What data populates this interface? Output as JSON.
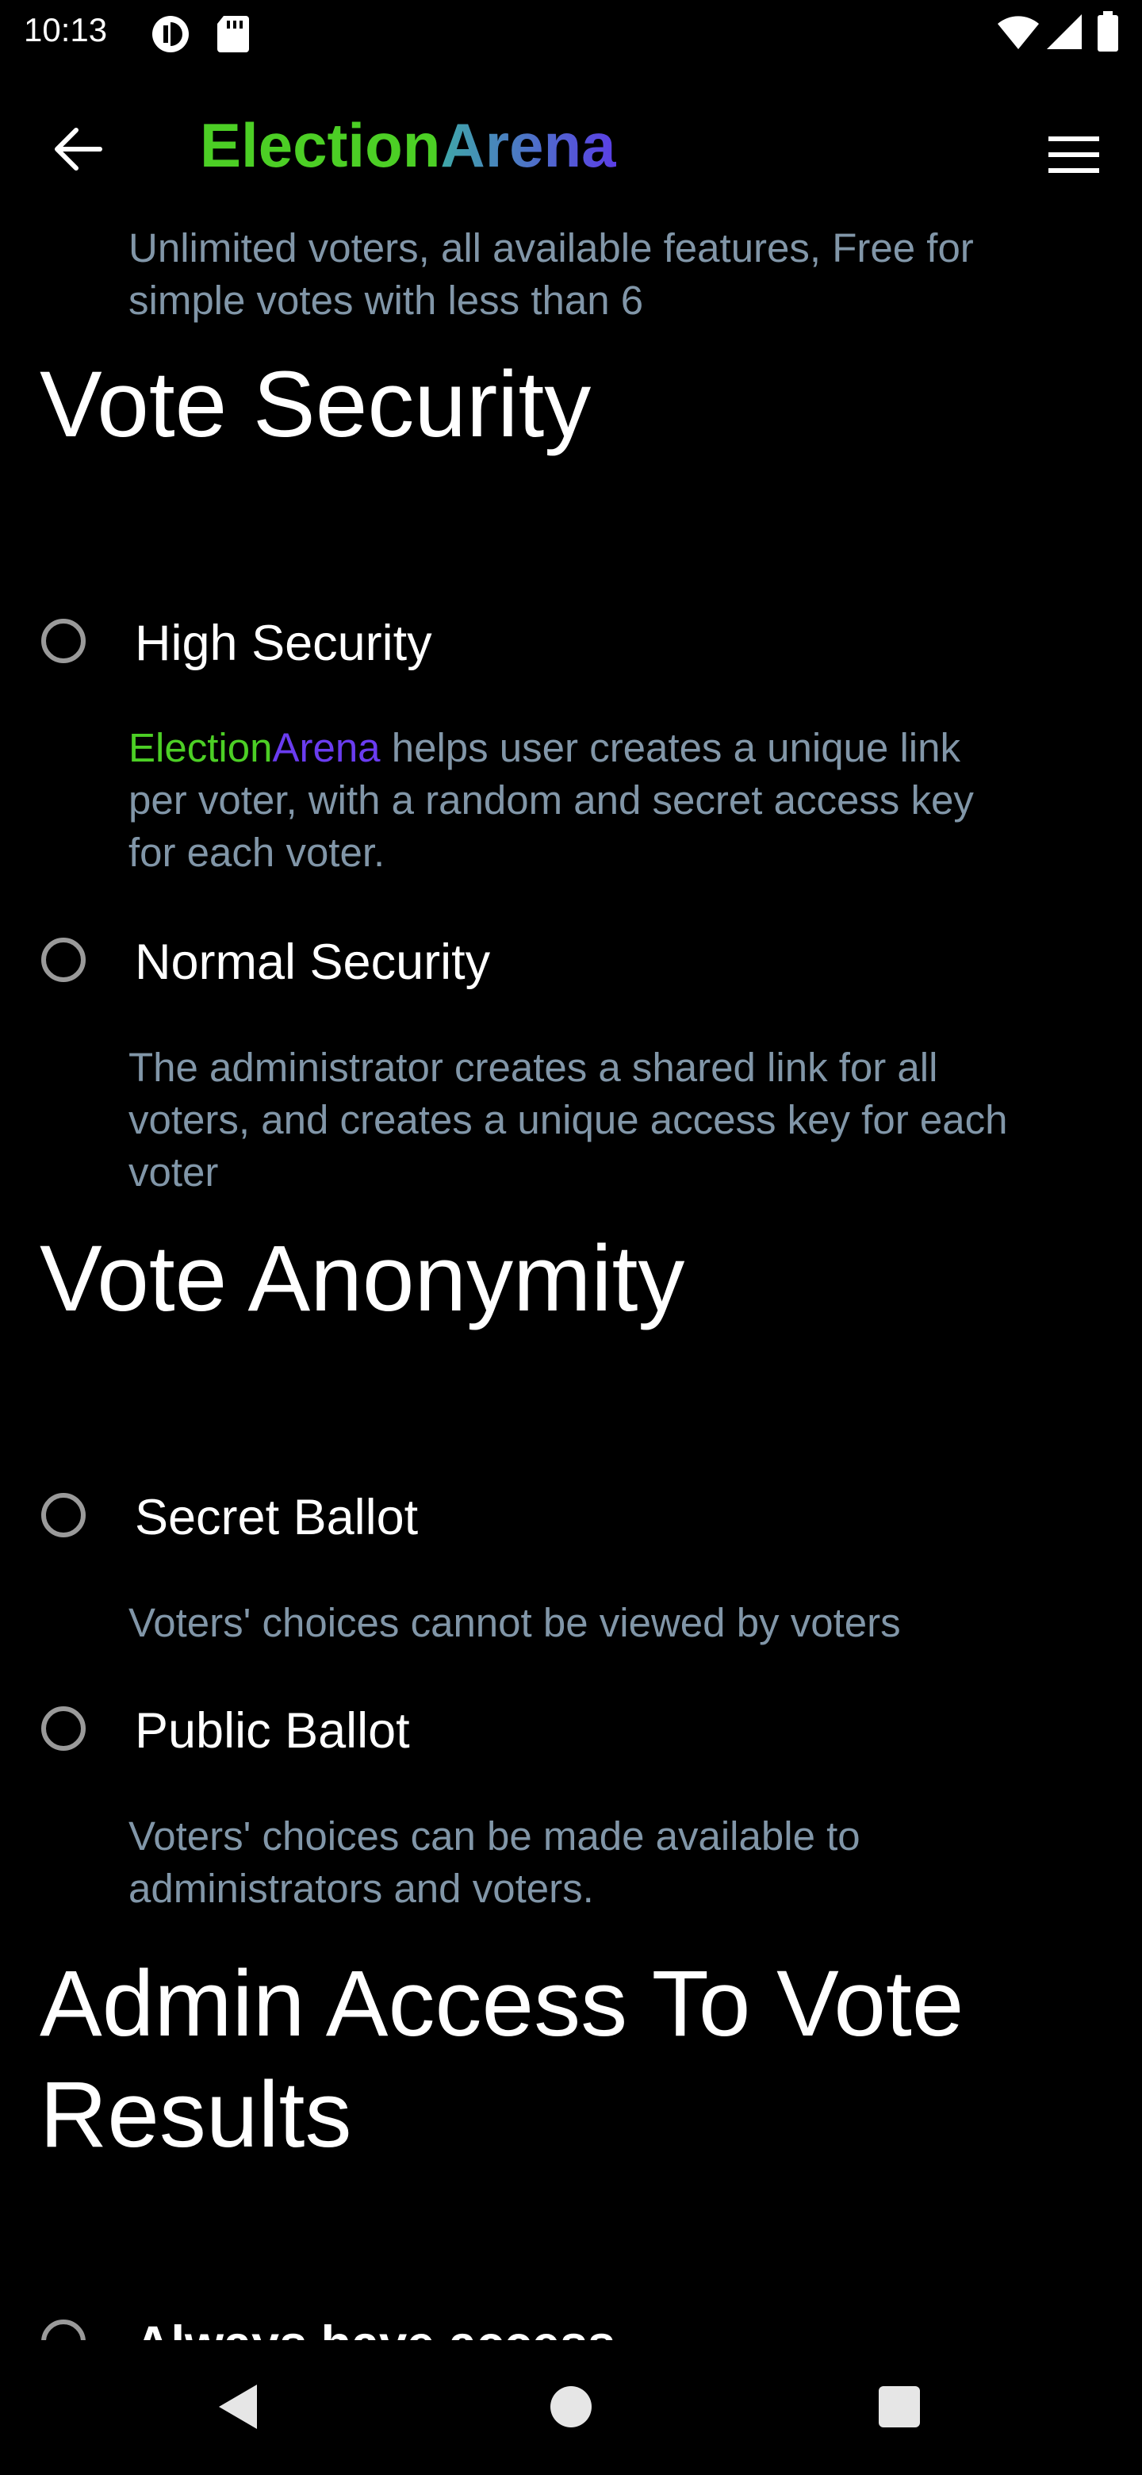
{
  "status_bar": {
    "time": "10:13"
  },
  "app_bar": {
    "title_part1": "Election",
    "title_part2": "Arena"
  },
  "content": {
    "top_desc": "Unlimited voters, all available features, Free for simple votes with less than 6",
    "sections": [
      {
        "heading": "Vote Security",
        "options": [
          {
            "label": "High Security",
            "desc_brand_1": "Election",
            "desc_brand_2": "Arena",
            "desc": " helps user creates a unique link per voter, with a random and secret access key for each voter."
          },
          {
            "label": "Normal Security",
            "desc": "The administrator creates a shared link for all voters, and creates a unique access key for each voter"
          }
        ]
      },
      {
        "heading": "Vote Anonymity",
        "options": [
          {
            "label": "Secret Ballot",
            "desc": "Voters' choices cannot be viewed by voters"
          },
          {
            "label": "Public Ballot",
            "desc": "Voters' choices can be made available to administrators and voters."
          }
        ]
      },
      {
        "heading": "Admin Access To Vote Results",
        "options": [
          {
            "label": "Always have access"
          }
        ]
      }
    ]
  },
  "colors": {
    "brand_green": "#4ccf25",
    "brand_purple": "#6a3cf0",
    "desc_text": "#8196a8",
    "background": "#000000"
  },
  "icons": {
    "status": [
      "app-notification-icon",
      "sd-card-icon",
      "wifi-icon",
      "cell-signal-icon",
      "battery-icon"
    ],
    "app_bar": [
      "back-arrow-icon",
      "hamburger-menu-icon"
    ],
    "nav": [
      "nav-back-icon",
      "nav-home-icon",
      "nav-recents-icon"
    ]
  }
}
